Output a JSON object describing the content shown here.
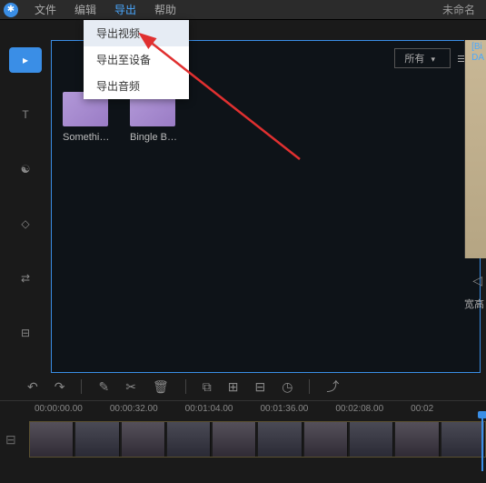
{
  "menubar": {
    "items": [
      "文件",
      "编辑",
      "导出",
      "帮助"
    ],
    "active_index": 2
  },
  "doc_title": "未命名",
  "dropdown": {
    "items": [
      "导出视频",
      "导出至设备",
      "导出音频"
    ],
    "hover_index": 0
  },
  "filter": {
    "label": "所有"
  },
  "thumbs": [
    {
      "label": "Something..."
    },
    {
      "label": "Bingle Ban..."
    }
  ],
  "preview": {
    "tag1": "[Bi",
    "tag2": "DA",
    "width_label": "宽高"
  },
  "ruler": [
    "00:00:00.00",
    "00:00:32.00",
    "00:01:04.00",
    "00:01:36.00",
    "00:02:08.00",
    "00:02"
  ]
}
